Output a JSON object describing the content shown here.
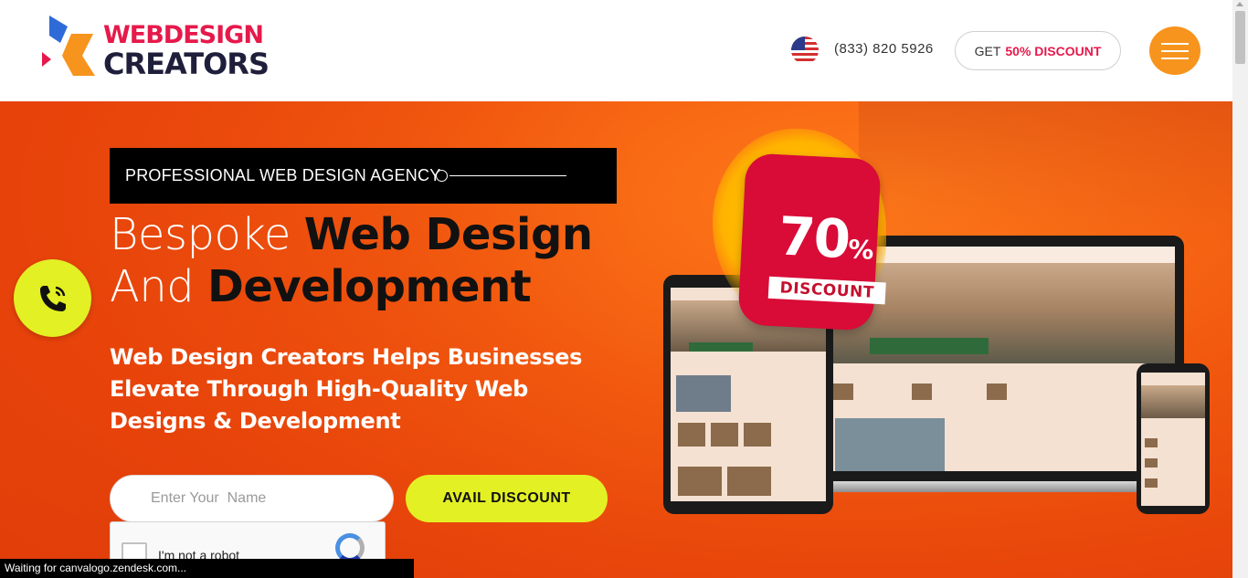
{
  "header": {
    "logo": {
      "line1": "WEBDESIGN",
      "line2": "CREATORS"
    },
    "phone": "(833) 820 5926",
    "discount_button": {
      "prefix": "GET",
      "highlight": "50% DISCOUNT"
    },
    "menu_icon": "hamburger-icon",
    "flag_icon": "us-flag-icon"
  },
  "hero": {
    "tagline": "PROFESSIONAL WEB DESIGN AGENCY",
    "headline": {
      "line1_light": "Bespoke ",
      "line1_bold": "Web Design",
      "line2_light": "And ",
      "line2_bold": "Development"
    },
    "subheadline": "Web Design Creators Helps Businesses Elevate Through High-Quality Web Designs & Development",
    "form": {
      "name_placeholder": "Enter Your  Name",
      "name_value": "",
      "submit_label": "AVAIL DISCOUNT"
    },
    "recaptcha": {
      "label": "I'm not a robot"
    },
    "promo_badge": {
      "number": "70",
      "percent": "%",
      "label": "DISCOUNT"
    },
    "call_icon": "phone-call-icon"
  },
  "status_bar": {
    "text": "Waiting for canvalogo.zendesk.com..."
  },
  "colors": {
    "brand_red": "#e6194b",
    "brand_navy": "#1f1f3c",
    "accent_orange": "#f7941d",
    "accent_lime": "#e3f024",
    "hero_orange": "#f25a0f"
  }
}
